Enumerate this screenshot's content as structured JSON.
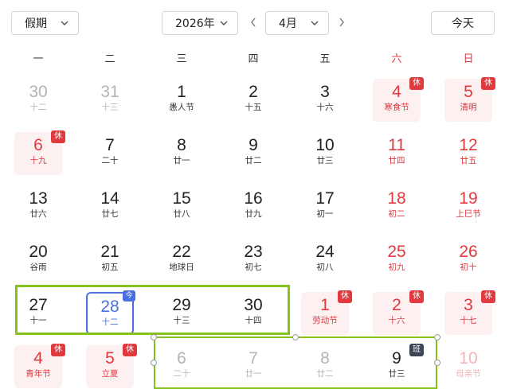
{
  "toolbar": {
    "holiday_select": "假期",
    "year_select": "2026年",
    "month_select": "4月",
    "today_button": "今天"
  },
  "weekdays": [
    "一",
    "二",
    "三",
    "四",
    "五",
    "六",
    "日"
  ],
  "days": [
    {
      "num": "30",
      "sub": "十二",
      "state": "muted"
    },
    {
      "num": "31",
      "sub": "十三",
      "state": "muted"
    },
    {
      "num": "1",
      "sub": "愚人节",
      "state": "normal"
    },
    {
      "num": "2",
      "sub": "十五",
      "state": "normal"
    },
    {
      "num": "3",
      "sub": "十六",
      "state": "normal"
    },
    {
      "num": "4",
      "sub": "寒食节",
      "state": "red",
      "holiday": true,
      "badge": "休"
    },
    {
      "num": "5",
      "sub": "清明",
      "state": "red",
      "holiday": true,
      "badge": "休"
    },
    {
      "num": "6",
      "sub": "十九",
      "state": "red",
      "holiday": true,
      "badge": "休"
    },
    {
      "num": "7",
      "sub": "二十",
      "state": "normal"
    },
    {
      "num": "8",
      "sub": "廿一",
      "state": "normal"
    },
    {
      "num": "9",
      "sub": "廿二",
      "state": "normal"
    },
    {
      "num": "10",
      "sub": "廿三",
      "state": "normal"
    },
    {
      "num": "11",
      "sub": "廿四",
      "state": "red"
    },
    {
      "num": "12",
      "sub": "廿五",
      "state": "red"
    },
    {
      "num": "13",
      "sub": "廿六",
      "state": "normal"
    },
    {
      "num": "14",
      "sub": "廿七",
      "state": "normal"
    },
    {
      "num": "15",
      "sub": "廿八",
      "state": "normal"
    },
    {
      "num": "16",
      "sub": "廿九",
      "state": "normal"
    },
    {
      "num": "17",
      "sub": "初一",
      "state": "normal"
    },
    {
      "num": "18",
      "sub": "初二",
      "state": "red"
    },
    {
      "num": "19",
      "sub": "上巳节",
      "state": "red"
    },
    {
      "num": "20",
      "sub": "谷雨",
      "state": "normal"
    },
    {
      "num": "21",
      "sub": "初五",
      "state": "normal"
    },
    {
      "num": "22",
      "sub": "地球日",
      "state": "normal"
    },
    {
      "num": "23",
      "sub": "初七",
      "state": "normal"
    },
    {
      "num": "24",
      "sub": "初八",
      "state": "normal"
    },
    {
      "num": "25",
      "sub": "初九",
      "state": "red"
    },
    {
      "num": "26",
      "sub": "初十",
      "state": "red"
    },
    {
      "num": "27",
      "sub": "十一",
      "state": "normal"
    },
    {
      "num": "28",
      "sub": "十二",
      "state": "today",
      "badge": "今"
    },
    {
      "num": "29",
      "sub": "十三",
      "state": "normal"
    },
    {
      "num": "30",
      "sub": "十四",
      "state": "normal"
    },
    {
      "num": "1",
      "sub": "劳动节",
      "state": "red",
      "holiday": true,
      "badge": "休"
    },
    {
      "num": "2",
      "sub": "十六",
      "state": "red",
      "holiday": true,
      "badge": "休"
    },
    {
      "num": "3",
      "sub": "十七",
      "state": "red",
      "holiday": true,
      "badge": "休"
    },
    {
      "num": "4",
      "sub": "青年节",
      "state": "red",
      "holiday": true,
      "badge": "休"
    },
    {
      "num": "5",
      "sub": "立夏",
      "state": "red",
      "holiday": true,
      "badge": "休"
    },
    {
      "num": "6",
      "sub": "二十",
      "state": "muted"
    },
    {
      "num": "7",
      "sub": "廿一",
      "state": "muted"
    },
    {
      "num": "8",
      "sub": "廿二",
      "state": "muted"
    },
    {
      "num": "9",
      "sub": "廿三",
      "state": "normal",
      "badge": "班"
    },
    {
      "num": "10",
      "sub": "母亲节",
      "state": "weekend-muted"
    }
  ]
}
